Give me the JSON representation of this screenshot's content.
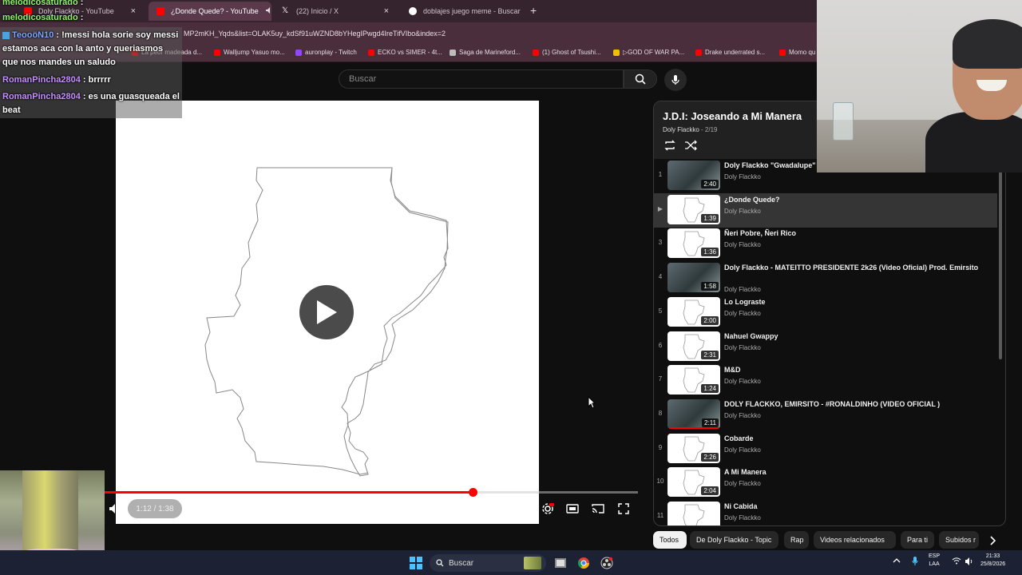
{
  "browser": {
    "tabs": [
      {
        "label": "Doly Flackko - YouTube",
        "color": "#ff0000"
      },
      {
        "label": "¿Donde Quede? - YouTube",
        "color": "#ff0000"
      },
      {
        "label": "(22) Inicio / X",
        "color": "#ffffff"
      },
      {
        "label": "doblajes juego meme - Buscar",
        "color": "#4285f4"
      }
    ],
    "new_tab": "+",
    "close_glyph": "×",
    "url": "MP2mKH_Yqds&list=OLAK5uy_kdSf91uWZND8bYHegIPwgd4IreTifVIbo&index=2",
    "bookmarks": [
      {
        "label": "La peor madeada d...",
        "color": "#ff0000"
      },
      {
        "label": "Walljump Yasuo mo...",
        "color": "#ff0000"
      },
      {
        "label": "auronplay - Twitch",
        "color": "#9146ff"
      },
      {
        "label": "ECKO vs SIMER - 4t...",
        "color": "#ff0000"
      },
      {
        "label": "Saga de Marineford...",
        "color": "#bbbbbb"
      },
      {
        "label": "(1) Ghost of Tsushi...",
        "color": "#ff0000"
      },
      {
        "label": "▷GOD OF WAR PA...",
        "color": "#f0c000"
      },
      {
        "label": "Drake underrated s...",
        "color": "#ff0000"
      },
      {
        "label": "Momo qu",
        "color": "#ff0000"
      }
    ]
  },
  "youtube": {
    "search_placeholder": "Buscar"
  },
  "player": {
    "time": "1:12 / 1:38",
    "progress": 0.69
  },
  "playlist": {
    "title": "J.D.I: Joseando a Mi Manera",
    "channel": "Doly Flackko",
    "position": "2/19",
    "items": [
      {
        "num": "1",
        "title": "Doly Flackko \"Gwadalupe\" (",
        "channel": "Doly Flackko",
        "duration": "2:40",
        "thumb": "photo"
      },
      {
        "num": "▶",
        "title": "¿Donde Quede?",
        "channel": "Doly Flackko",
        "duration": "1:39",
        "thumb": "map",
        "current": true
      },
      {
        "num": "3",
        "title": "Ñeri Pobre, Ñeri Rico",
        "channel": "Doly Flackko",
        "duration": "1:36",
        "thumb": "map"
      },
      {
        "num": "4",
        "title": "Doly Flackko - MATEITTO PRESIDENTE 2k26 (Video Oficial) Prod. Emirsito",
        "channel": "Doly Flackko",
        "duration": "1:58",
        "thumb": "photo"
      },
      {
        "num": "5",
        "title": "Lo Lograste",
        "channel": "Doly Flackko",
        "duration": "2:00",
        "thumb": "map"
      },
      {
        "num": "6",
        "title": "Nahuel Gwappy",
        "channel": "Doly Flackko",
        "duration": "2:31",
        "thumb": "map"
      },
      {
        "num": "7",
        "title": "M&D",
        "channel": "Doly Flackko",
        "duration": "1:24",
        "thumb": "map"
      },
      {
        "num": "8",
        "title": "DOLY FLACKKO, EMIRSITO - #RONALDINHO (VIDEO OFICIAL )",
        "channel": "Doly Flackko",
        "duration": "2:11",
        "thumb": "photo",
        "watched": 1.0
      },
      {
        "num": "9",
        "title": "Cobarde",
        "channel": "Doly Flackko",
        "duration": "2:26",
        "thumb": "map"
      },
      {
        "num": "10",
        "title": "A Mi Manera",
        "channel": "Doly Flackko",
        "duration": "2:04",
        "thumb": "map"
      },
      {
        "num": "11",
        "title": "Ni Cabida",
        "channel": "Doly Flackko",
        "duration": "",
        "thumb": "map"
      }
    ]
  },
  "chips": [
    "Todos",
    "De Doly Flackko - Topic",
    "Rap",
    "Videos relacionados",
    "Para ti",
    "Subidos r"
  ],
  "chat": [
    {
      "user": "melodicosaturado",
      "text": " :",
      "color": "green"
    },
    {
      "user": "melodicosaturado",
      "text": " :",
      "color": "green"
    },
    {
      "user": "TeooöN10",
      "text": " : !messi hola sorie soy messi estamos aca con la anto y queriasmos que nos mandes un saludo",
      "color": "blue"
    },
    {
      "user": "RomanPincha2804",
      "text": " : brrrrr",
      "color": "purple"
    },
    {
      "user": "RomanPincha2804",
      "text": " : es una guasqueada el beat",
      "color": "purple"
    }
  ],
  "taskbar": {
    "search_label": "Buscar",
    "lang": "ESP",
    "layout": "LAA",
    "time": "21:33",
    "date": "25/8/2026"
  },
  "colors": {
    "accent_red": "#ff0000",
    "bg": "#0f0f0f"
  }
}
